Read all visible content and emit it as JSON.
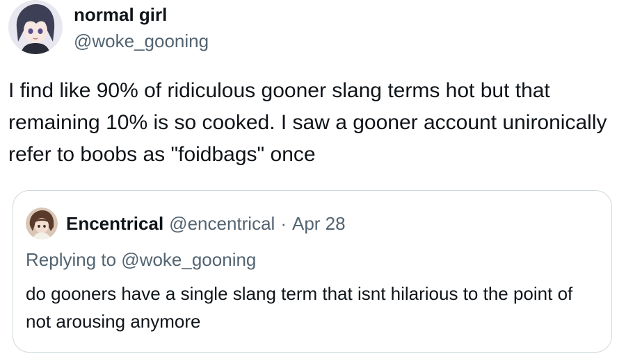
{
  "tweet": {
    "author": {
      "display_name": "normal girl",
      "handle": "@woke_gooning",
      "avatar_icon": "anime-girl-avatar-icon"
    },
    "text": "I find like 90% of ridiculous gooner slang terms hot but that remaining 10% is so cooked. I saw a gooner account unironically refer to boobs as \"foidbags\" once"
  },
  "quoted_tweet": {
    "author": {
      "display_name": "Encentrical",
      "handle": "@encentrical",
      "separator": "·",
      "date": "Apr 28",
      "avatar_icon": "anime-character-avatar-icon"
    },
    "replying_to": "Replying to @woke_gooning",
    "text": "do gooners have a single slang term that isnt hilarious to the point of not arousing anymore"
  },
  "colors": {
    "primary_text": "#0f1419",
    "secondary_text": "#536471",
    "border": "#cfd9de"
  }
}
